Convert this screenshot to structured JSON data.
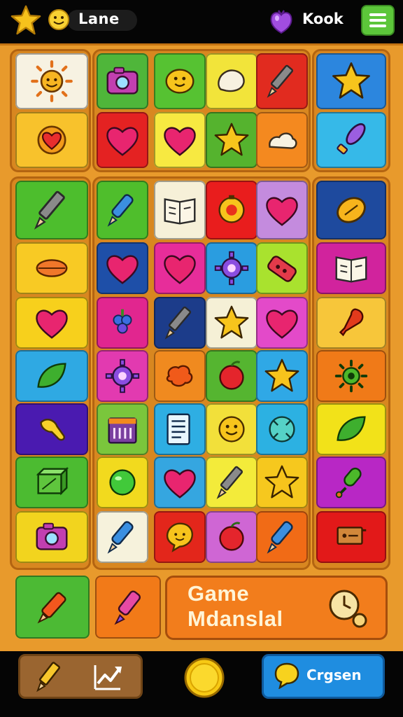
{
  "top_bar": {
    "player_name": "Lane",
    "score_label": "Kook",
    "icons": [
      "star-icon",
      "smiley-icon",
      "gem-icon",
      "menu-icon"
    ],
    "menu_color": "#5cc63a"
  },
  "board": {
    "frame_color": "#e89a2c",
    "tiles": [
      {
        "color": "#f7f2e2",
        "icon": "sun-icon"
      },
      {
        "color": "#f8c22c",
        "icon": "heart-sun-icon"
      },
      {
        "color": "#4fb63a",
        "icon": "camera-icon"
      },
      {
        "color": "#56c232",
        "icon": "smiley-blob-icon"
      },
      {
        "color": "#f2e43a",
        "icon": "speech-bubble-icon"
      },
      {
        "color": "#e12b1f",
        "icon": "pencil-icon"
      },
      {
        "color": "#e42222",
        "icon": "heart-icon"
      },
      {
        "color": "#f7e941",
        "icon": "heart-icon"
      },
      {
        "color": "#55b32e",
        "icon": "star-icon"
      },
      {
        "color": "#f4891f",
        "icon": "cloud-bubble-icon"
      },
      {
        "color": "#2c86de",
        "icon": "star-icon"
      },
      {
        "color": "#36b9e8",
        "icon": "brush-icon"
      },
      {
        "color": "#4dbe2d",
        "icon": "pencil-icon"
      },
      {
        "color": "#f8ca24",
        "icon": "oval-icon"
      },
      {
        "color": "#f7d01c",
        "icon": "heart-icon"
      },
      {
        "color": "#2fa9e3",
        "icon": "leaf-icon"
      },
      {
        "color": "#4a1ab0",
        "icon": "hand-icon"
      },
      {
        "color": "#4cbb31",
        "icon": "box-icon"
      },
      {
        "color": "#f2d41e",
        "icon": "camera-icon"
      },
      {
        "color": "#4fbe2c",
        "icon": "marker-icon"
      },
      {
        "color": "#f6f0d8",
        "icon": "book-icon"
      },
      {
        "color": "#e91d1d",
        "icon": "face-icon"
      },
      {
        "color": "#c48bde",
        "icon": "heart-icon"
      },
      {
        "color": "#1e4fa8",
        "icon": "heart-icon"
      },
      {
        "color": "#e72d9a",
        "icon": "heart-icon"
      },
      {
        "color": "#2a9de0",
        "icon": "gear-icon"
      },
      {
        "color": "#a9e22e",
        "icon": "battery-icon"
      },
      {
        "color": "#e1268f",
        "icon": "grape-icon"
      },
      {
        "color": "#1c3c8a",
        "icon": "pencil-icon"
      },
      {
        "color": "#f5f0d6",
        "icon": "star-icon"
      },
      {
        "color": "#e34ac9",
        "icon": "heart-icon"
      },
      {
        "color": "#e23ab0",
        "icon": "gear-icon"
      },
      {
        "color": "#f08a1f",
        "icon": "splat-icon"
      },
      {
        "color": "#55b530",
        "icon": "apple-icon"
      },
      {
        "color": "#2fa8e6",
        "icon": "star-icon"
      },
      {
        "color": "#7ac63c",
        "icon": "calendar-icon"
      },
      {
        "color": "#2eaee3",
        "icon": "document-icon"
      },
      {
        "color": "#f2e03a",
        "icon": "smiley-icon"
      },
      {
        "color": "#2cb1e2",
        "icon": "round-icon"
      },
      {
        "color": "#f2da1e",
        "icon": "circle-icon"
      },
      {
        "color": "#35a6e0",
        "icon": "heart-icon"
      },
      {
        "color": "#f3eb3a",
        "icon": "pencil-icon"
      },
      {
        "color": "#f6c81e",
        "icon": "star-icon"
      },
      {
        "color": "#f6f2dc",
        "icon": "marker-icon"
      },
      {
        "color": "#e3261b",
        "icon": "smiley-bubble-icon"
      },
      {
        "color": "#cf66d4",
        "icon": "apple-icon"
      },
      {
        "color": "#f16b16",
        "icon": "marker-icon"
      },
      {
        "color": "#1e4a9e",
        "icon": "lemon-icon"
      },
      {
        "color": "#d1239d",
        "icon": "book-icon"
      },
      {
        "color": "#f7c63a",
        "icon": "pin-icon"
      },
      {
        "color": "#f07a18",
        "icon": "sun-gear-icon"
      },
      {
        "color": "#f2e219",
        "icon": "leaf-icon"
      },
      {
        "color": "#b827c5",
        "icon": "microphone-icon"
      },
      {
        "color": "#e21919",
        "icon": "sign-icon"
      },
      {
        "color": "#e02424",
        "icon": "cloud-icon"
      },
      {
        "color": "#4cba34",
        "icon": "marker-icon"
      },
      {
        "color": "#f27a18",
        "icon": "glue-icon"
      }
    ]
  },
  "banner": {
    "line1": "Game",
    "line2": "Mdanslal",
    "color": "#f27d1c"
  },
  "bottom_bar": {
    "right_label": "Crgsen",
    "left_icons": [
      "pencil-icon",
      "chart-icon"
    ],
    "coin_color": "#f7c914",
    "right_color": "#1f8de0"
  }
}
